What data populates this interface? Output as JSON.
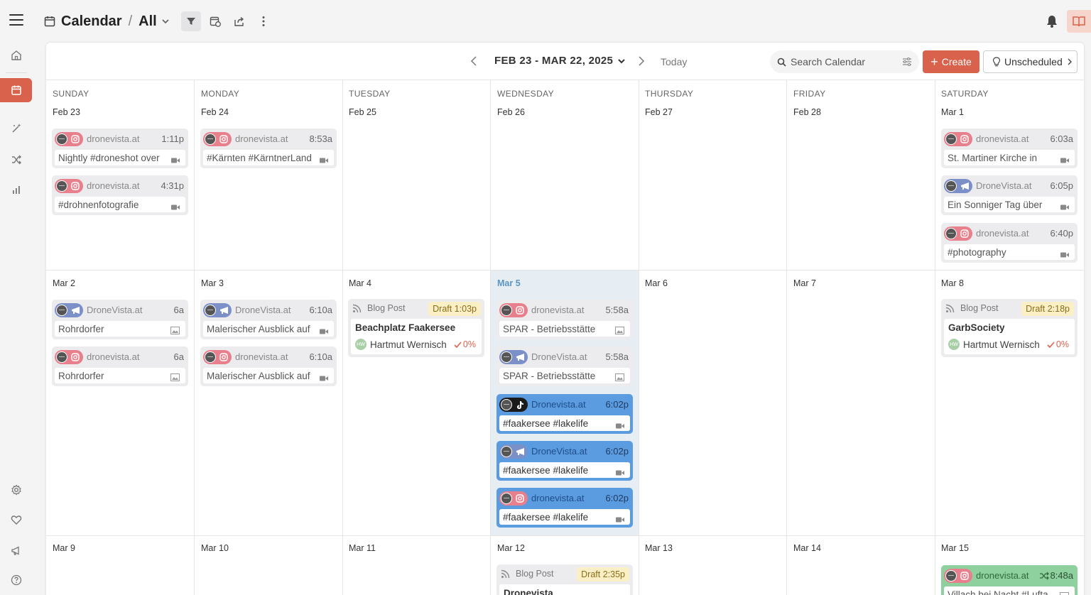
{
  "header": {
    "title": "Calendar",
    "separator": "/",
    "view": "All"
  },
  "toolbar": {
    "range": "FEB 23 - MAR 22, 2025",
    "today_label": "Today",
    "search_placeholder": "Search Calendar",
    "create_label": "Create",
    "create_plus": "+",
    "unscheduled_label": "Unscheduled"
  },
  "colors": {
    "accent": "#d9624c",
    "instagram_tint": "#e7808c",
    "twitter_tint": "#7b8fc9",
    "highlight_day": "#5b95c4",
    "selected_card": "#5b9be0",
    "green_card": "#8fd19e"
  },
  "days": [
    "SUNDAY",
    "MONDAY",
    "TUESDAY",
    "WEDNESDAY",
    "THURSDAY",
    "FRIDAY",
    "SATURDAY"
  ],
  "weeks": [
    [
      "Feb 23",
      "Feb 24",
      "Feb 25",
      "Feb 26",
      "Feb 27",
      "Feb 28",
      "Mar 1"
    ],
    [
      "Mar 2",
      "Mar 3",
      "Mar 4",
      "Mar 5",
      "Mar 6",
      "Mar 7",
      "Mar 8"
    ],
    [
      "Mar 9",
      "Mar 10",
      "Mar 11",
      "Mar 12",
      "Mar 13",
      "Mar 14",
      "Mar 15"
    ]
  ],
  "posts": {
    "w0sun_1": {
      "account": "dronevista.at",
      "time": "1:11p",
      "caption": "Nightly #droneshot over",
      "platform": "instagram-icon",
      "media": "video-icon"
    },
    "w0sun_2": {
      "account": "dronevista.at",
      "time": "4:31p",
      "caption": "#drohnenfotografie",
      "platform": "instagram-icon",
      "media": "video-icon"
    },
    "w0mon_1": {
      "account": "dronevista.at",
      "time": "8:53a",
      "caption": "#Kärnten #KärntnerLand",
      "platform": "instagram-icon",
      "media": "video-icon"
    },
    "w0sat_1": {
      "account": "dronevista.at",
      "time": "6:03a",
      "caption": "St. Martiner Kirche in",
      "platform": "instagram-icon",
      "media": "video-icon"
    },
    "w0sat_2": {
      "account": "DroneVista.at",
      "time": "6:05p",
      "caption": "Ein Sonniger Tag über",
      "platform": "megaphone-icon",
      "media": "video-icon"
    },
    "w0sat_3": {
      "account": "dronevista.at",
      "time": "6:40p",
      "caption": "#photography",
      "platform": "instagram-icon",
      "media": "video-icon"
    },
    "w1sun_1": {
      "account": "DroneVista.at",
      "time": "6a",
      "caption": "Rohrdorfer",
      "platform": "megaphone-icon",
      "media": "image-icon"
    },
    "w1sun_2": {
      "account": "dronevista.at",
      "time": "6a",
      "caption": "Rohrdorfer",
      "platform": "instagram-icon",
      "media": "image-icon"
    },
    "w1mon_1": {
      "account": "DroneVista.at",
      "time": "6:10a",
      "caption": "Malerischer Ausblick auf",
      "platform": "megaphone-icon",
      "media": "video-icon"
    },
    "w1mon_2": {
      "account": "dronevista.at",
      "time": "6:10a",
      "caption": "Malerischer Ausblick auf",
      "platform": "instagram-icon",
      "media": "video-icon"
    },
    "w1wed_1": {
      "account": "dronevista.at",
      "time": "5:58a",
      "caption": "SPAR - Betriebsstätte",
      "platform": "instagram-icon",
      "media": "image-icon"
    },
    "w1wed_2": {
      "account": "DroneVista.at",
      "time": "5:58a",
      "caption": "SPAR - Betriebsstätte",
      "platform": "megaphone-icon",
      "media": "image-icon"
    },
    "w1wed_3": {
      "account": "Dronevista.at",
      "time": "6:02p",
      "caption": "#faakersee #lakelife",
      "platform": "tiktok-icon",
      "media": "video-icon"
    },
    "w1wed_4": {
      "account": "DroneVista.at",
      "time": "6:02p",
      "caption": "#faakersee #lakelife",
      "platform": "megaphone-icon",
      "media": "video-icon"
    },
    "w1wed_5": {
      "account": "dronevista.at",
      "time": "6:02p",
      "caption": "#faakersee #lakelife",
      "platform": "instagram-icon",
      "media": "video-icon"
    },
    "w2sat_1": {
      "account": "dronevista.at",
      "time": "8:48a",
      "caption": "Villach bei Nacht #Lufta",
      "platform": "instagram-icon",
      "media": "image-icon"
    }
  },
  "blogs": {
    "w1tue": {
      "type_label": "Blog Post",
      "status": "Draft",
      "time": "1:03p",
      "title": "Beachplatz Faakersee",
      "author": "Hartmut Wernisch",
      "initials": "HW",
      "progress": "0%"
    },
    "w1sat": {
      "type_label": "Blog Post",
      "status": "Draft",
      "time": "2:18p",
      "title": "GarbSociety",
      "author": "Hartmut Wernisch",
      "initials": "HW",
      "progress": "0%"
    },
    "w2wed": {
      "type_label": "Blog Post",
      "status": "Draft",
      "time": "2:35p",
      "title": "Dronevista",
      "author": "",
      "initials": "",
      "progress": ""
    }
  }
}
